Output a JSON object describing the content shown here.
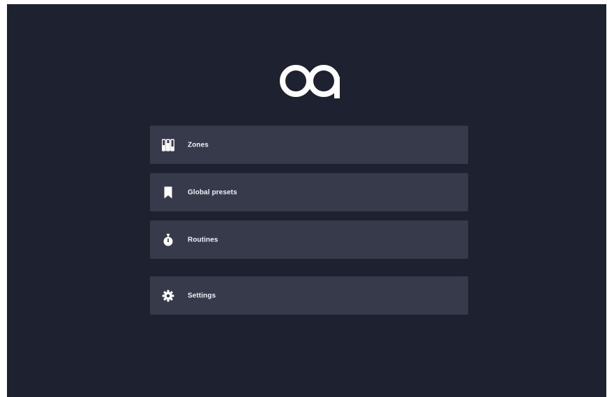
{
  "app": {
    "logo_icon": "oa-logo-icon",
    "background_color": "#1e2230",
    "item_color": "#363a4b",
    "text_color": "#f1f2f6"
  },
  "menu": {
    "items": [
      {
        "label": "Zones",
        "icon": "zones-icon"
      },
      {
        "label": "Global presets",
        "icon": "bookmark-icon"
      },
      {
        "label": "Routines",
        "icon": "stopwatch-icon"
      },
      {
        "label": "Settings",
        "icon": "gear-icon"
      }
    ]
  }
}
